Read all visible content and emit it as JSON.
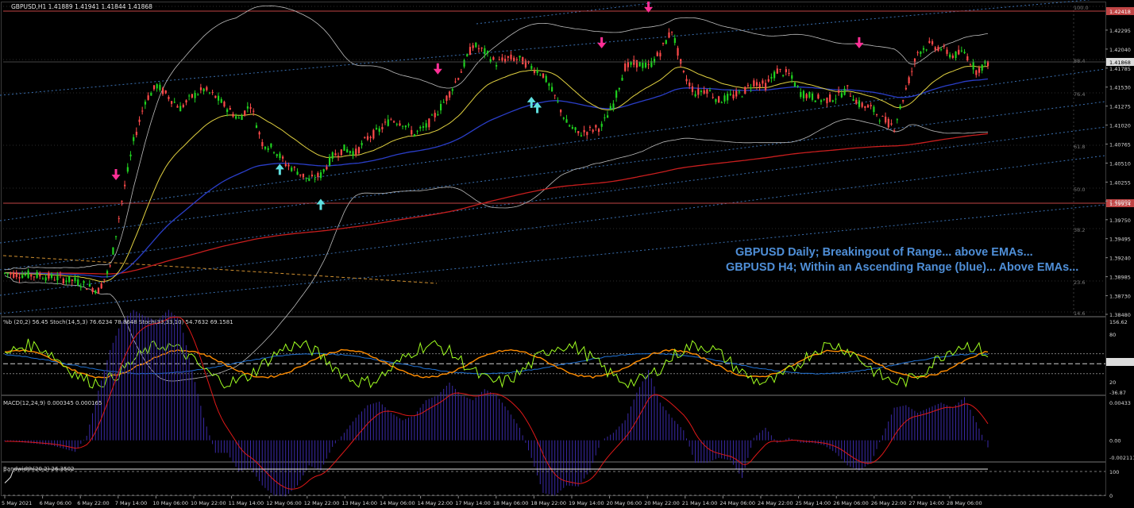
{
  "chart_data": {
    "type": "candlestick",
    "symbol_header": "GBPUSD,H1  1.41889 1.41941 1.41844 1.41868",
    "price_axis": {
      "ticks": [
        "1.42295",
        "1.42040",
        "1.41785",
        "1.41530",
        "1.41275",
        "1.41020",
        "1.40765",
        "1.40510",
        "1.40255",
        "1.40000",
        "1.39750",
        "1.39495",
        "1.39240",
        "1.38985",
        "1.38730",
        "1.38480"
      ],
      "values": [
        1.42295,
        1.4204,
        1.41785,
        1.4153,
        1.41275,
        1.4102,
        1.40765,
        1.4051,
        1.40255,
        1.4,
        1.3975,
        1.39495,
        1.3924,
        1.38985,
        1.3873,
        1.3848
      ],
      "ylim": [
        1.3848,
        1.4255
      ],
      "current_price": "1.41868",
      "horizontal_lines": [
        {
          "label": "1.42418",
          "value": 1.42418
        },
        {
          "label": "1.39934",
          "value": 1.39934
        }
      ]
    },
    "fibo_levels": [
      "100.0",
      "88.4",
      "76.4",
      "61.8",
      "50.0",
      "38.2",
      "23.6",
      "14.6"
    ],
    "time_axis": [
      "5 May 2021",
      "6 May 06:00",
      "6 May 22:00",
      "7 May 14:00",
      "10 May 06:00",
      "10 May 22:00",
      "11 May 14:00",
      "12 May 06:00",
      "12 May 22:00",
      "13 May 14:00",
      "14 May 06:00",
      "14 May 22:00",
      "17 May 14:00",
      "18 May 06:00",
      "18 May 22:00",
      "19 May 14:00",
      "20 May 06:00",
      "20 May 22:00",
      "21 May 14:00",
      "24 May 06:00",
      "24 May 22:00",
      "25 May 14:00",
      "26 May 06:00",
      "26 May 22:00",
      "27 May 14:00",
      "28 May 06:00"
    ],
    "close_trajectory": [
      [
        0,
        1.3903
      ],
      [
        3,
        1.39
      ],
      [
        6,
        1.3893
      ],
      [
        8,
        1.388
      ],
      [
        9,
        1.3911
      ],
      [
        10,
        1.4
      ],
      [
        11,
        1.408
      ],
      [
        12,
        1.4135
      ],
      [
        13,
        1.4155
      ],
      [
        14,
        1.414
      ],
      [
        15,
        1.4125
      ],
      [
        16,
        1.414
      ],
      [
        17,
        1.415
      ],
      [
        18,
        1.414
      ],
      [
        19,
        1.4125
      ],
      [
        20,
        1.411
      ],
      [
        21,
        1.413
      ],
      [
        22,
        1.4078
      ],
      [
        23,
        1.407
      ],
      [
        24,
        1.405
      ],
      [
        25,
        1.404
      ],
      [
        26,
        1.4028
      ],
      [
        27,
        1.4035
      ],
      [
        28,
        1.406
      ],
      [
        29,
        1.407
      ],
      [
        30,
        1.4065
      ],
      [
        31,
        1.4085
      ],
      [
        32,
        1.4095
      ],
      [
        33,
        1.411
      ],
      [
        34,
        1.4105
      ],
      [
        35,
        1.409
      ],
      [
        36,
        1.41
      ],
      [
        37,
        1.412
      ],
      [
        38,
        1.4145
      ],
      [
        39,
        1.4175
      ],
      [
        40,
        1.421
      ],
      [
        41,
        1.42
      ],
      [
        42,
        1.4185
      ],
      [
        43,
        1.4192
      ],
      [
        44,
        1.419
      ],
      [
        45,
        1.418
      ],
      [
        46,
        1.417
      ],
      [
        47,
        1.414
      ],
      [
        48,
        1.4105
      ],
      [
        49,
        1.409
      ],
      [
        50,
        1.4095
      ],
      [
        51,
        1.41
      ],
      [
        52,
        1.413
      ],
      [
        53,
        1.418
      ],
      [
        54,
        1.4185
      ],
      [
        55,
        1.418
      ],
      [
        56,
        1.42
      ],
      [
        57,
        1.423
      ],
      [
        58,
        1.417
      ],
      [
        59,
        1.4145
      ],
      [
        60,
        1.415
      ],
      [
        61,
        1.4135
      ],
      [
        62,
        1.414
      ],
      [
        63,
        1.4145
      ],
      [
        64,
        1.416
      ],
      [
        65,
        1.4155
      ],
      [
        66,
        1.4175
      ],
      [
        67,
        1.417
      ],
      [
        68,
        1.4145
      ],
      [
        69,
        1.414
      ],
      [
        70,
        1.4135
      ],
      [
        71,
        1.414
      ],
      [
        72,
        1.415
      ],
      [
        73,
        1.413
      ],
      [
        74,
        1.4125
      ],
      [
        75,
        1.411
      ],
      [
        76,
        1.41
      ],
      [
        77,
        1.415
      ],
      [
        78,
        1.42
      ],
      [
        79,
        1.421
      ],
      [
        80,
        1.4205
      ],
      [
        81,
        1.4195
      ],
      [
        82,
        1.42
      ],
      [
        83,
        1.4175
      ],
      [
        84,
        1.4186
      ]
    ],
    "signal_arrows": [
      {
        "dir": "down",
        "idx": 9.5,
        "price": 1.4028
      },
      {
        "dir": "up",
        "idx": 23.5,
        "price": 1.405
      },
      {
        "dir": "up",
        "idx": 27,
        "price": 1.4003
      },
      {
        "dir": "down",
        "idx": 37,
        "price": 1.417
      },
      {
        "dir": "up",
        "idx": 45,
        "price": 1.414
      },
      {
        "dir": "up",
        "idx": 45.5,
        "price": 1.4133
      },
      {
        "dir": "down",
        "idx": 51,
        "price": 1.4205
      },
      {
        "dir": "down",
        "idx": 55,
        "price": 1.4253
      },
      {
        "dir": "down",
        "idx": 73,
        "price": 1.4205
      }
    ],
    "annotations": [
      "GBPUSD Daily; Breakingout of Range... above EMAs...",
      "GBPUSD H4; Within an Ascending Range (blue)... Above EMAs..."
    ],
    "subpanels": [
      {
        "name": "%b / Stochastic",
        "header": "%b (20,2) 56.45  Stoch(14,5,3) 76.6234 78.8648  Stoch(33,33,10) 54.7632 69.1581",
        "axis_labels": [
          "156.62",
          "80",
          "50.24",
          "20",
          "-36.87"
        ],
        "ylim": [
          -40,
          160
        ]
      },
      {
        "name": "MACD",
        "header": "MACD(12,24,9) 0.000345 0.000165",
        "axis_labels": [
          "0.00433",
          "0.00",
          "-0.002111"
        ],
        "ylim": [
          -0.0022,
          0.0045
        ]
      },
      {
        "name": "Bandwidth",
        "header": "Bandwidth(20,2) 26.3502",
        "axis_labels": [
          "100",
          "0"
        ],
        "ylim": [
          0,
          120
        ]
      }
    ],
    "colors": {
      "background": "#000000",
      "bull_candle": "#1fd21f",
      "bear_candle": "#ff4a4a",
      "ema_fast": "#e0d040",
      "ema_mid": "#2a3ec8",
      "ema_slow": "#c81e1e",
      "bollinger": "#bcbcbc",
      "channel": "#3a6fb0",
      "arrow_down": "#ff2f96",
      "arrow_up": "#5fe0e0",
      "percent_b": "#a0ff20",
      "stoch_fast": "#ff8c00",
      "stoch_slow": "#1f6fd0",
      "macd_hist": "#3a2aa8",
      "macd_signal": "#e01818",
      "bandwidth": "#e6e6e6",
      "annotation": "#4f8fd8"
    }
  }
}
